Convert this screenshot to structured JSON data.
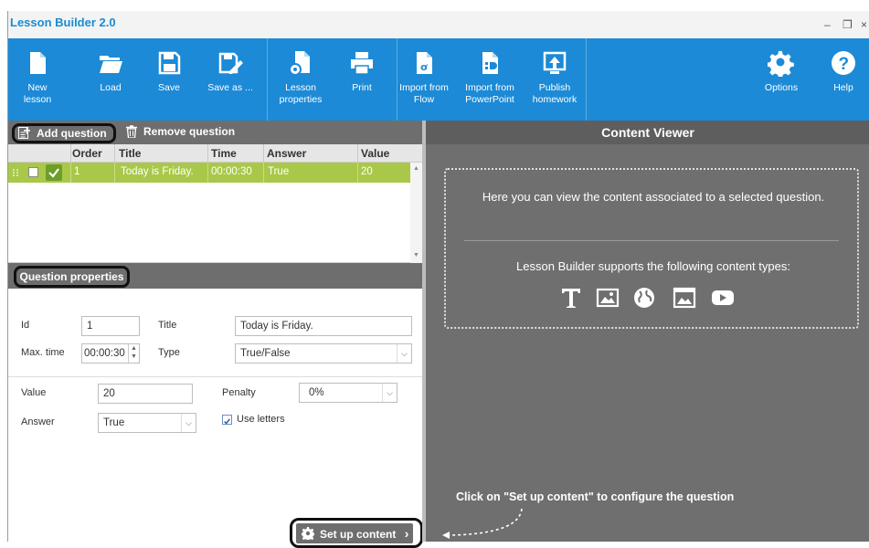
{
  "window": {
    "title": "Lesson Builder 2.0",
    "minimize": "–",
    "restore": "❐",
    "close": "×"
  },
  "toolbar": {
    "new_lesson": "New\nlesson",
    "load": "Load",
    "save": "Save",
    "save_as": "Save as ...",
    "lesson_properties": "Lesson\nproperties",
    "print": "Print",
    "import_flow": "Import from\nFlow",
    "import_ppt": "Import from\nPowerPoint",
    "publish_homework": "Publish\nhomework",
    "options": "Options",
    "help": "Help"
  },
  "questions": {
    "add_label": "Add question",
    "remove_label": "Remove question",
    "columns": [
      "Order",
      "Title",
      "Time",
      "Answer",
      "Value"
    ],
    "rows": [
      {
        "order": "1",
        "title": "Today is Friday.",
        "time": "00:00:30",
        "answer": "True",
        "value": "20",
        "checked": true
      }
    ]
  },
  "properties": {
    "header": "Question properties",
    "id_label": "Id",
    "id_value": "1",
    "title_label": "Title",
    "title_value": "Today is Friday.",
    "maxtime_label": "Max. time",
    "maxtime_value": "00:00:30",
    "type_label": "Type",
    "type_value": "True/False",
    "value_label": "Value",
    "value_value": "20",
    "penalty_label": "Penalty",
    "penalty_value": "0%",
    "answer_label": "Answer",
    "answer_value": "True",
    "use_letters_label": "Use letters",
    "use_letters_checked": true
  },
  "setup": {
    "label": "Set up content",
    "chevron": "›"
  },
  "content_viewer": {
    "title": "Content Viewer",
    "intro": "Here you can view the content associated to a selected question.",
    "supports": "Lesson Builder supports the following content types:",
    "content_types": [
      "text-icon",
      "image-icon",
      "web-icon",
      "slide-icon",
      "video-icon"
    ],
    "hint": "Click on \"Set up content\" to configure the question"
  },
  "colors": {
    "accent": "#1c8ad6",
    "selected_row": "#a9c84a",
    "panel_dark": "#6f6f6f",
    "header_dark": "#5e5e5e"
  }
}
